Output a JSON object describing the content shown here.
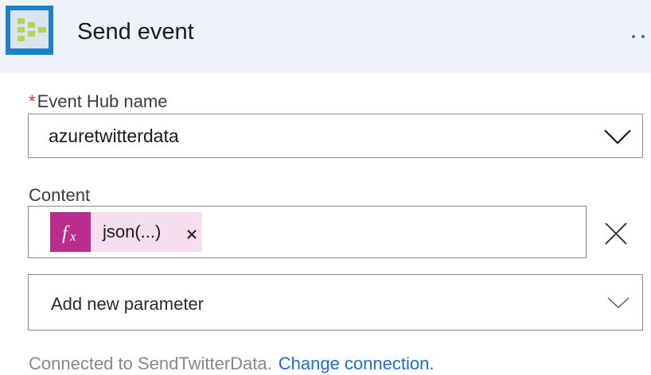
{
  "action": {
    "title": "Send event",
    "icon": "event-hub-icon",
    "more_icon": "more-options-icon"
  },
  "fields": {
    "event_hub_name": {
      "label": "Event Hub name",
      "required": true,
      "value": "azuretwitterdata",
      "icon": "chevron-down-icon"
    },
    "content": {
      "label": "Content",
      "token": {
        "icon_text": "fx",
        "label": "json(...)",
        "remove_label": "×"
      },
      "clear_icon": "close-icon"
    },
    "add_parameter": {
      "placeholder": "Add new parameter",
      "icon": "chevron-down-icon"
    }
  },
  "footer": {
    "connected_text": "Connected to SendTwitterData.",
    "change_link": "Change connection."
  },
  "colors": {
    "header_bg": "#eef2fb",
    "icon_bg": "#1d80c8",
    "expression_token": "#b92d8e",
    "expression_token_bg": "#f7deef",
    "link": "#1f6fc5",
    "required": "#d13438"
  }
}
